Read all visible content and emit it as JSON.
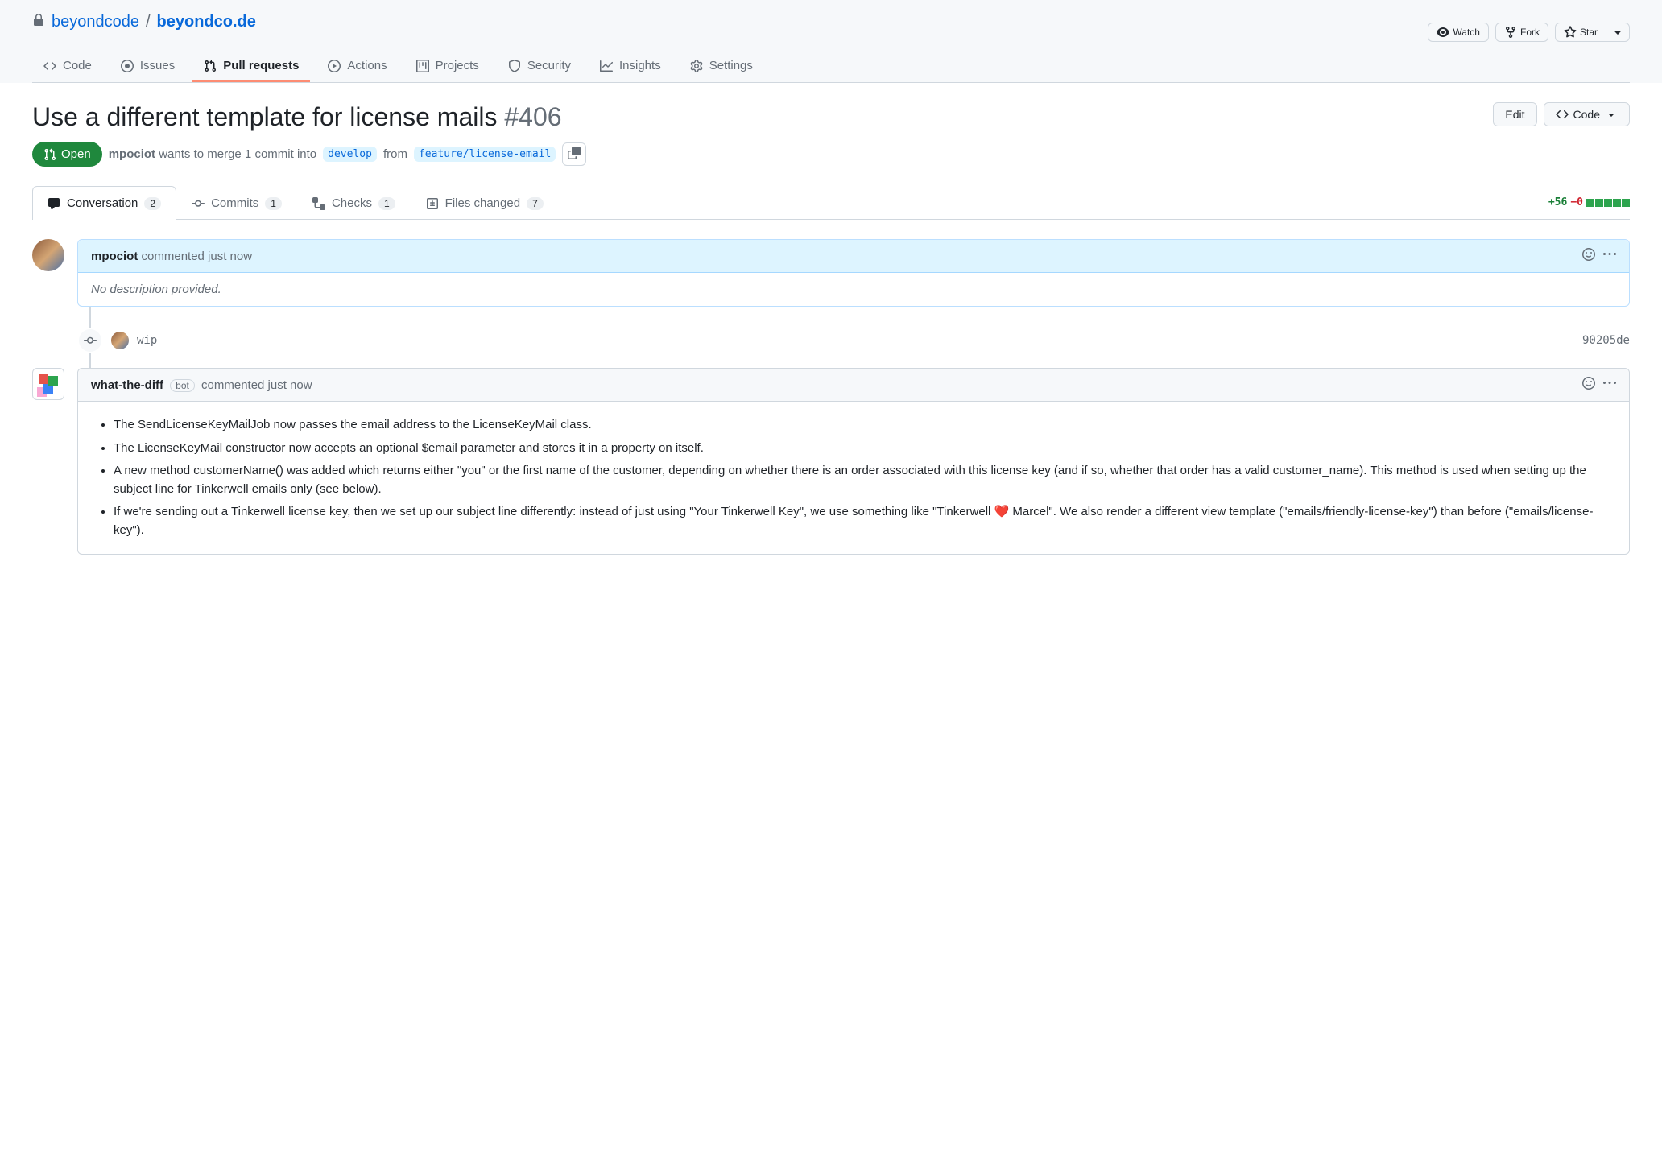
{
  "breadcrumb": {
    "owner": "beyondcode",
    "repo": "beyondco.de"
  },
  "header_actions": {
    "watch": "Watch",
    "fork": "Fork",
    "star": "Star"
  },
  "repo_nav": [
    {
      "label": "Code",
      "icon": "code"
    },
    {
      "label": "Issues",
      "icon": "issue"
    },
    {
      "label": "Pull requests",
      "icon": "pr",
      "active": true
    },
    {
      "label": "Actions",
      "icon": "play"
    },
    {
      "label": "Projects",
      "icon": "project"
    },
    {
      "label": "Security",
      "icon": "shield"
    },
    {
      "label": "Insights",
      "icon": "graph"
    },
    {
      "label": "Settings",
      "icon": "gear"
    }
  ],
  "pr": {
    "title": "Use a different template for license mails",
    "number": "#406",
    "state": "Open",
    "author": "mpociot",
    "merge_text_1": "wants to merge 1 commit into",
    "base_branch": "develop",
    "merge_text_2": "from",
    "head_branch": "feature/license-email",
    "edit_btn": "Edit",
    "code_btn": "Code"
  },
  "pr_tabs": [
    {
      "label": "Conversation",
      "count": "2",
      "icon": "comment",
      "active": true
    },
    {
      "label": "Commits",
      "count": "1",
      "icon": "commit"
    },
    {
      "label": "Checks",
      "count": "1",
      "icon": "check"
    },
    {
      "label": "Files changed",
      "count": "7",
      "icon": "diff"
    }
  ],
  "diffstat": {
    "additions": "+56",
    "deletions": "−0"
  },
  "comment1": {
    "author": "mpociot",
    "meta": "commented just now",
    "body": "No description provided."
  },
  "commit": {
    "message": "wip",
    "sha": "90205de"
  },
  "comment2": {
    "author": "what-the-diff",
    "badge": "bot",
    "meta": "commented just now",
    "bullets": [
      "The SendLicenseKeyMailJob now passes the email address to the LicenseKeyMail class.",
      "The LicenseKeyMail constructor now accepts an optional $email parameter and stores it in a property on itself.",
      "A new method customerName() was added which returns either \"you\" or the first name of the customer, depending on whether there is an order associated with this license key (and if so, whether that order has a valid customer_name). This method is used when setting up the subject line for Tinkerwell emails only (see below).",
      "If we're sending out a Tinkerwell license key, then we set up our subject line differently: instead of just using \"Your Tinkerwell Key\", we use something like \"Tinkerwell ❤️ Marcel\". We also render a different view template (\"emails/friendly-license-key\") than before (\"emails/license-key\")."
    ]
  }
}
